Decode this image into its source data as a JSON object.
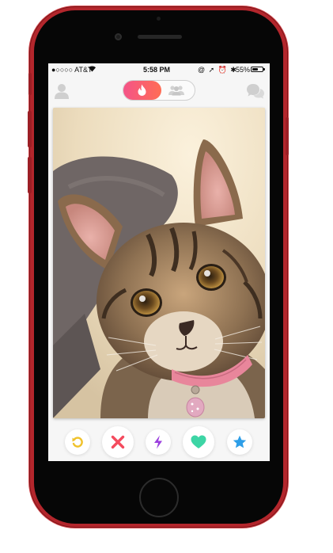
{
  "status_bar": {
    "carrier": "●○○○○ AT&T",
    "time": "5:58 PM",
    "icons": "@ ➚ ⏰ ✱",
    "battery_text": "55%",
    "battery_level": 0.55
  },
  "header": {
    "left_icon": "profile-icon",
    "right_icon": "chat-bubbles-icon",
    "mode_toggle": {
      "active": "flame-icon",
      "inactive": "group-icon"
    }
  },
  "card": {
    "photo": "tabby-kitten-photo"
  },
  "actions": [
    {
      "icon": "rewind-icon",
      "color": "#f0c22b"
    },
    {
      "icon": "nope-x-icon",
      "color": "#f44b5e"
    },
    {
      "icon": "boost-bolt-icon",
      "color": "#9b3fde"
    },
    {
      "icon": "like-heart-icon",
      "color": "#3dd5a5"
    },
    {
      "icon": "super-like-star-icon",
      "color": "#2d9ee8"
    }
  ],
  "colors": {
    "accent_gradient_start": "#f45488",
    "accent_gradient_end": "#ff6d55",
    "phone_red": "#b3262c"
  }
}
